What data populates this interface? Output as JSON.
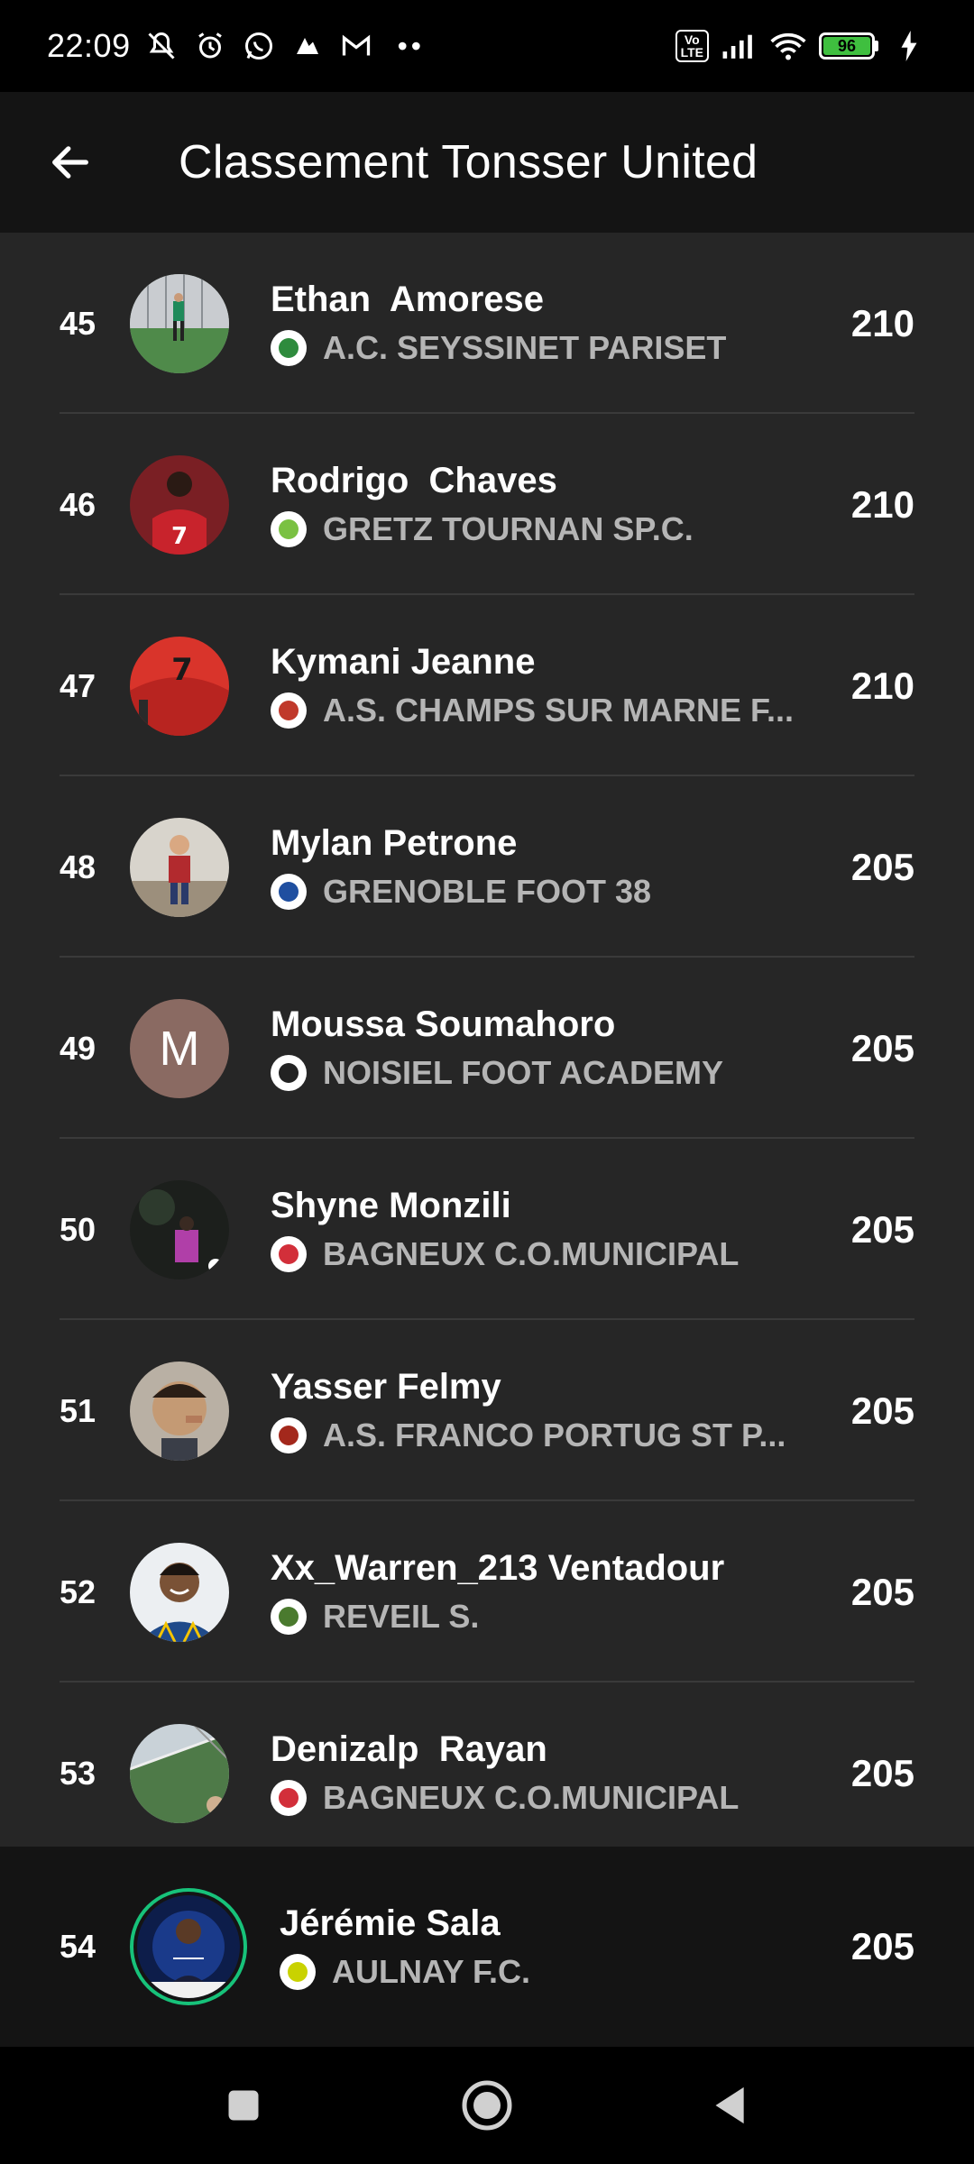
{
  "status_bar": {
    "time": "22:09",
    "dots": "••",
    "volte": "Vo\nLTE",
    "battery": "96"
  },
  "app_bar": {
    "title": "Classement Tonsser United"
  },
  "players": [
    {
      "rank": "45",
      "name": "Ethan  Amorese",
      "club": "A.C. SEYSSINET PARISET",
      "points": "210",
      "badge_color": "#2e8b3d"
    },
    {
      "rank": "46",
      "name": "Rodrigo  Chaves",
      "club": "GRETZ TOURNAN SP.C.",
      "points": "210",
      "badge_color": "#7ac142"
    },
    {
      "rank": "47",
      "name": "Kymani Jeanne",
      "club": "A.S. CHAMPS SUR MARNE F...",
      "points": "210",
      "badge_color": "#c0392b"
    },
    {
      "rank": "48",
      "name": "Mylan Petrone",
      "club": "GRENOBLE FOOT 38",
      "points": "205",
      "badge_color": "#1f4fa0"
    },
    {
      "rank": "49",
      "name": "Moussa Soumahoro",
      "avatar_letter": "M",
      "club": "NOISIEL FOOT ACADEMY",
      "points": "205",
      "badge_color": "#222222"
    },
    {
      "rank": "50",
      "name": "Shyne Monzili",
      "club": "BAGNEUX C.O.MUNICIPAL",
      "points": "205",
      "badge_color": "#d22f3a"
    },
    {
      "rank": "51",
      "name": "Yasser Felmy",
      "club": "A.S. FRANCO PORTUG ST P...",
      "points": "205",
      "badge_color": "#a3281c"
    },
    {
      "rank": "52",
      "name": "Xx_Warren_213 Ventadour",
      "club": "REVEIL S.",
      "points": "205",
      "badge_color": "#4a7a2e"
    },
    {
      "rank": "53",
      "name": "Denizalp  Rayan",
      "club": "BAGNEUX C.O.MUNICIPAL",
      "points": "205",
      "badge_color": "#d22f3a"
    }
  ],
  "current_user": {
    "rank": "54",
    "name": "Jérémie Sala",
    "club": "AULNAY F.C.",
    "points": "205",
    "badge_color": "#c9d200",
    "ring_color": "#17c27a"
  }
}
